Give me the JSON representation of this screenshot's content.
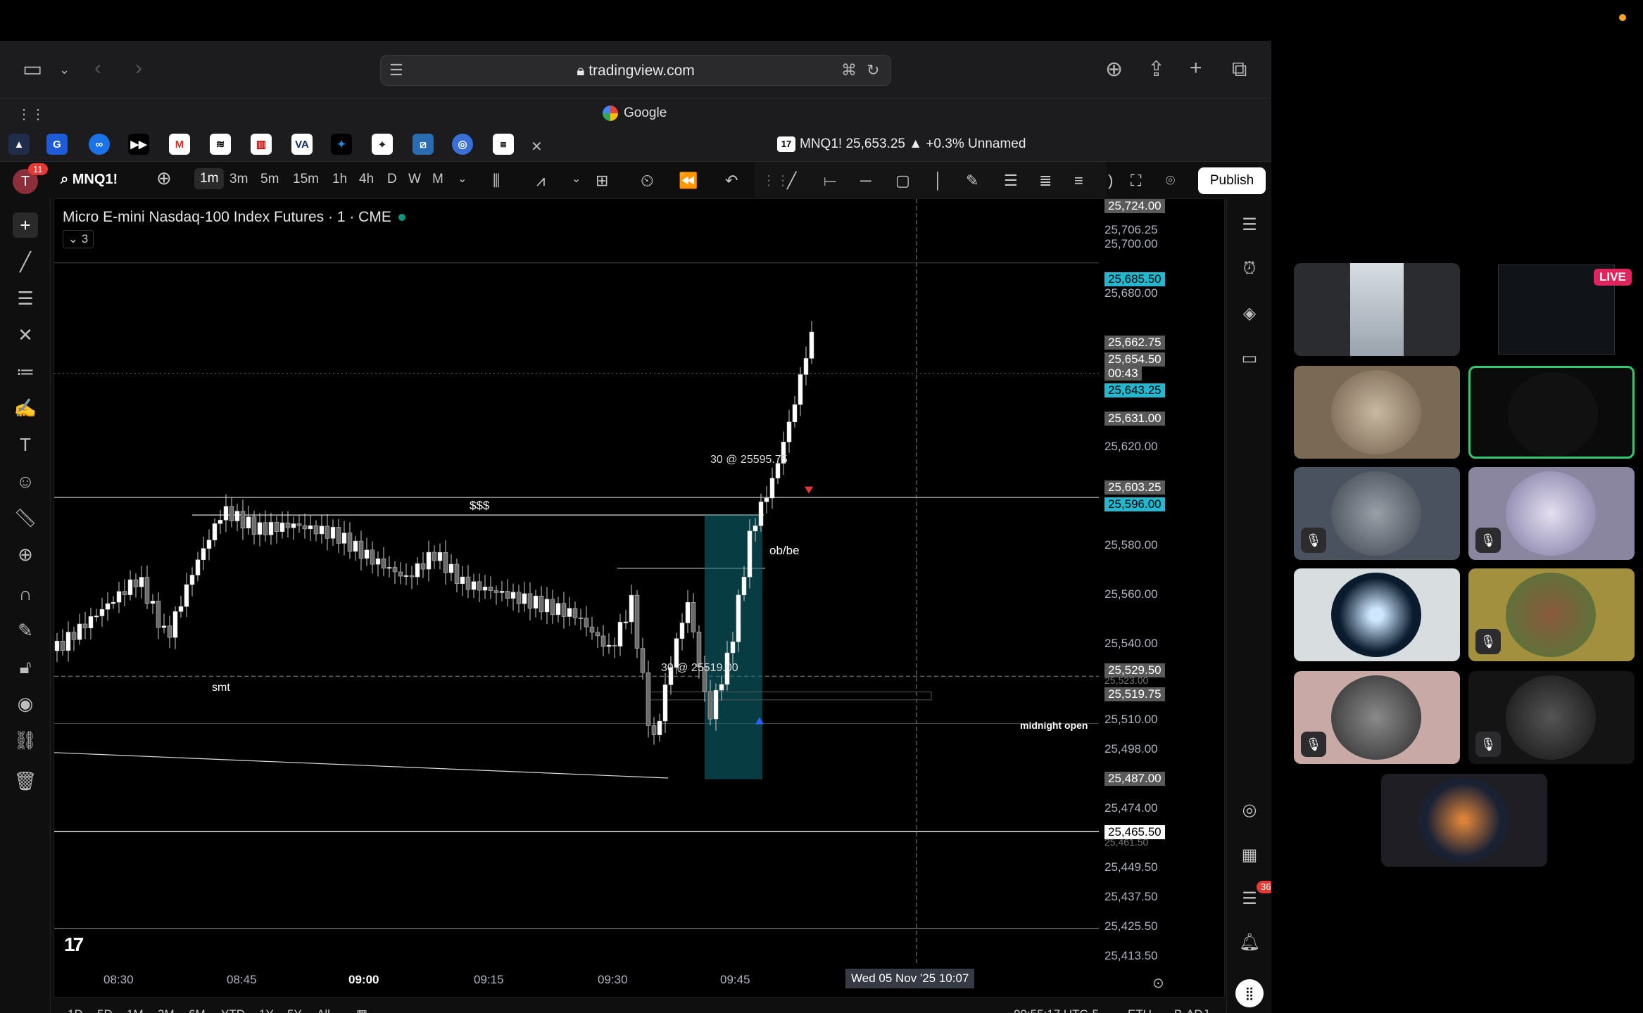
{
  "browser": {
    "url": "tradingview.com",
    "favorites_title": "Google",
    "active_tab_title": "MNQ1! 25,653.25 ▲ +0.3% Unnamed"
  },
  "tv": {
    "notification_count": "11",
    "avatar_letter": "T",
    "symbol": "MNQ1!",
    "timeframes": [
      "1m",
      "3m",
      "5m",
      "15m",
      "1h",
      "4h",
      "D",
      "W",
      "M"
    ],
    "publish_label": "Publish",
    "chart_title": "Micro E-mini Nasdaq-100 Index Futures · 1 · CME",
    "collapse_label": "3",
    "crosshair_time": "Wed 05 Nov '25   10:07",
    "session_time": "09:55:17 UTC-5",
    "session": "ETH",
    "adj": "B-ADJ",
    "ranges": [
      "1D",
      "5D",
      "1M",
      "3M",
      "6M",
      "YTD",
      "1Y",
      "5Y",
      "All"
    ],
    "alerts_count": "36"
  },
  "chart_data": {
    "type": "candlestick",
    "xlabels": [
      "08:30",
      "08:45",
      "09:00",
      "09:15",
      "09:30",
      "09:45"
    ],
    "price_labels": [
      "25,724.00",
      "25,706.25",
      "25,700.00",
      "25,685.50",
      "25,680.00",
      "25,662.75",
      "25,654.50",
      "00:43",
      "25,643.25",
      "25,631.00",
      "25,620.00",
      "25,603.25",
      "25,596.00",
      "25,580.00",
      "25,560.00",
      "25,540.00",
      "25,529.50",
      "25,523.00",
      "25,519.75",
      "25,510.00",
      "25,498.00",
      "25,487.00",
      "25,474.00",
      "25,465.50",
      "25,461.50",
      "25,449.50",
      "25,437.50",
      "25,425.50",
      "25,413.50"
    ],
    "annotations": {
      "sss": "$$$",
      "obbe": "ob/be",
      "smt": "smt",
      "midnight": "midnight open",
      "buy_trade": "30 @ 25519.00",
      "sell_trade": "30 @ 25595.75"
    },
    "last_price": 25654.5,
    "ylim": [
      25413.5,
      25724.0
    ]
  },
  "participants": {
    "live_label": "LIVE"
  }
}
